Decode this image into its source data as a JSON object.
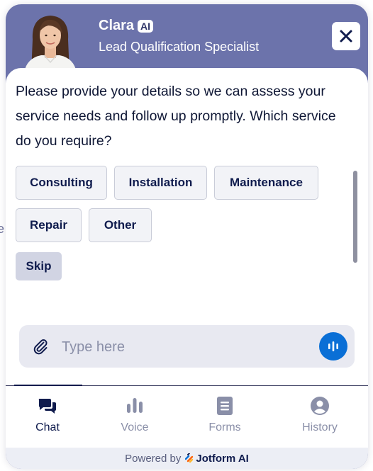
{
  "edge_text": "e",
  "header": {
    "agent_name": "Clara",
    "ai_badge": "AI",
    "agent_role": "Lead Qualification Specialist",
    "avatar_icon": "agent-avatar",
    "close_icon": "close-icon"
  },
  "chat": {
    "message": "Please provide your details so we can assess your service needs and follow up promptly. Which service do you require?",
    "options": [
      "Consulting",
      "Installation",
      "Maintenance",
      "Repair",
      "Other"
    ],
    "skip_label": "Skip"
  },
  "composer": {
    "placeholder": "Type here",
    "value": "",
    "attach_icon": "paperclip-icon",
    "voice_icon": "voice-wave-icon"
  },
  "tabs": [
    {
      "label": "Chat",
      "icon": "chat-icon",
      "active": true
    },
    {
      "label": "Voice",
      "icon": "voice-bars-icon",
      "active": false
    },
    {
      "label": "Forms",
      "icon": "forms-icon",
      "active": false
    },
    {
      "label": "History",
      "icon": "user-circle-icon",
      "active": false
    }
  ],
  "footer": {
    "powered_by": "Powered by",
    "brand": "Jotform AI"
  },
  "colors": {
    "header_bg": "#6c73ab",
    "accent_blue": "#0a6fd6",
    "text_dark": "#0f1b4d",
    "option_bg": "#f2f3f7",
    "skip_bg": "#d1d4e3"
  }
}
